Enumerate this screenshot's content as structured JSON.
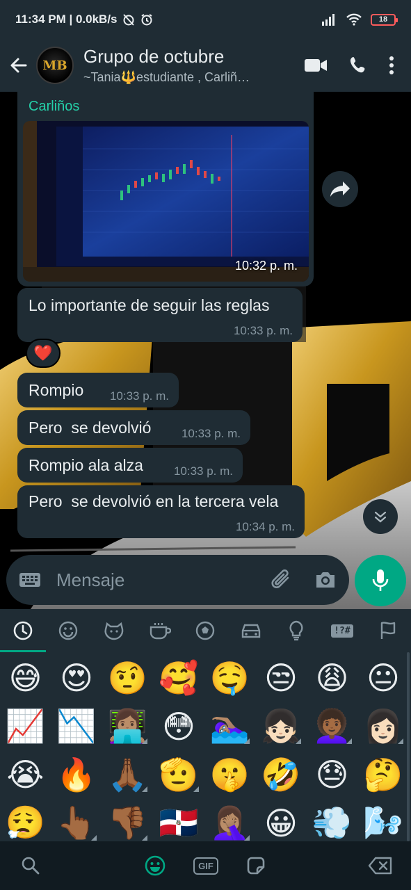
{
  "status_bar": {
    "time_speed": "11:34 PM | 0.0kB/s",
    "battery": "18"
  },
  "header": {
    "title": "Grupo de octubre",
    "subtitle": "~Tania🔱estudiante , Carliñ…",
    "avatar_text": "MB"
  },
  "messages": [
    {
      "sender": "Carliños",
      "type": "image",
      "time": "10:32 p. m."
    },
    {
      "text": "Lo importante de seguir las reglas",
      "time": "10:33 p. m.",
      "reaction": "❤️"
    },
    {
      "text": "Rompio",
      "time": "10:33 p. m."
    },
    {
      "text": "Pero  se devolvió",
      "time": "10:33 p. m."
    },
    {
      "text": "Rompio ala alza",
      "time": "10:33 p. m."
    },
    {
      "text": "Pero  se devolvió en la tercera vela",
      "time": "10:34 p. m."
    }
  ],
  "input": {
    "placeholder": "Mensaje"
  },
  "emoji_tabs": [
    "recent-icon",
    "smiley-icon",
    "animal-icon",
    "food-icon",
    "sport-icon",
    "travel-icon",
    "objects-icon",
    "symbols-icon",
    "flags-icon"
  ],
  "symbols_tab_label": "!?#",
  "emoji_rows": [
    [
      "😅",
      "😍",
      "🤨",
      "🥰",
      "🤤",
      "😒",
      "😩",
      "😐"
    ],
    [
      "📈",
      "📉",
      "👩🏽‍💻",
      "😳",
      "🏊🏽‍♀️",
      "👧🏻",
      "👩🏾‍🦱",
      "👩🏻"
    ],
    [
      "😭",
      "🔥",
      "🙏🏾",
      "🫡",
      "🤫",
      "🤣",
      "😓",
      "🤔"
    ],
    [
      "😮‍💨",
      "👆🏾",
      "👎🏾",
      "🇩🇴",
      "🤦🏽‍♀️",
      "😀",
      "💨",
      "🌬️"
    ]
  ],
  "emoji_tone_marks": [
    [
      false,
      false,
      false,
      false,
      false,
      false,
      false,
      false
    ],
    [
      false,
      false,
      true,
      false,
      true,
      true,
      true,
      true
    ],
    [
      false,
      false,
      true,
      true,
      false,
      false,
      false,
      false
    ],
    [
      false,
      true,
      true,
      false,
      true,
      false,
      false,
      false
    ]
  ],
  "keyboard_bottom": {
    "gif_label": "GIF"
  },
  "colors": {
    "accent": "#00a884",
    "bubble": "#1f2c34",
    "bar": "#1f2c34",
    "sender": "#25d0a9",
    "logo_gold": "#d9a52b"
  }
}
